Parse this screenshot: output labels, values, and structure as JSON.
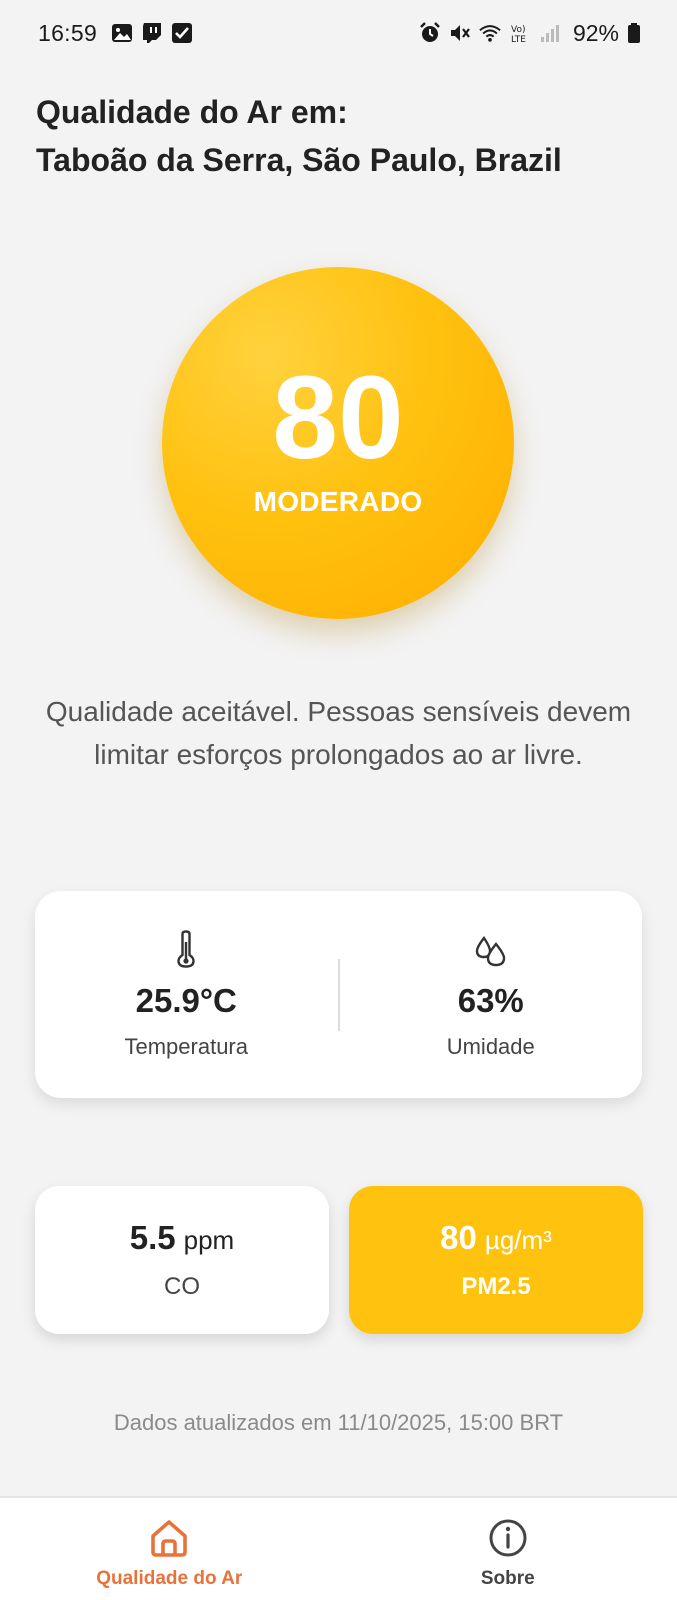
{
  "status_bar": {
    "time": "16:59",
    "battery": "92%",
    "left_icons": [
      "gallery-icon",
      "twitch-icon",
      "check-icon"
    ],
    "right_icons": [
      "alarm-icon",
      "mute-icon",
      "wifi-icon",
      "volte-icon",
      "signal-icon",
      "battery-icon"
    ]
  },
  "header": {
    "title_line1": "Qualidade do Ar em:",
    "title_line2": "Taboão da Serra, São Paulo, Brazil"
  },
  "aqi": {
    "value": "80",
    "label": "MODERADO",
    "color": "#ffc10f"
  },
  "description": "Qualidade aceitável. Pessoas sensíveis devem limitar esforços prolongados ao ar livre.",
  "weather": {
    "temperature": {
      "value": "25.9°C",
      "label": "Temperatura",
      "icon": "thermometer-icon"
    },
    "humidity": {
      "value": "63%",
      "label": "Umidade",
      "icon": "droplets-icon"
    }
  },
  "pollutants": {
    "co": {
      "value": "5.5",
      "unit": "ppm",
      "name": "CO"
    },
    "pm25": {
      "value": "80",
      "unit": "µg/m³",
      "name": "PM2.5",
      "color": "#ffc20e"
    }
  },
  "updated": "Dados atualizados em 11/10/2025, 15:00 BRT",
  "nav": {
    "items": [
      {
        "label": "Qualidade do Ar",
        "icon": "home-icon",
        "active": true,
        "color": "#e8733a"
      },
      {
        "label": "Sobre",
        "icon": "info-icon",
        "active": false
      }
    ]
  }
}
